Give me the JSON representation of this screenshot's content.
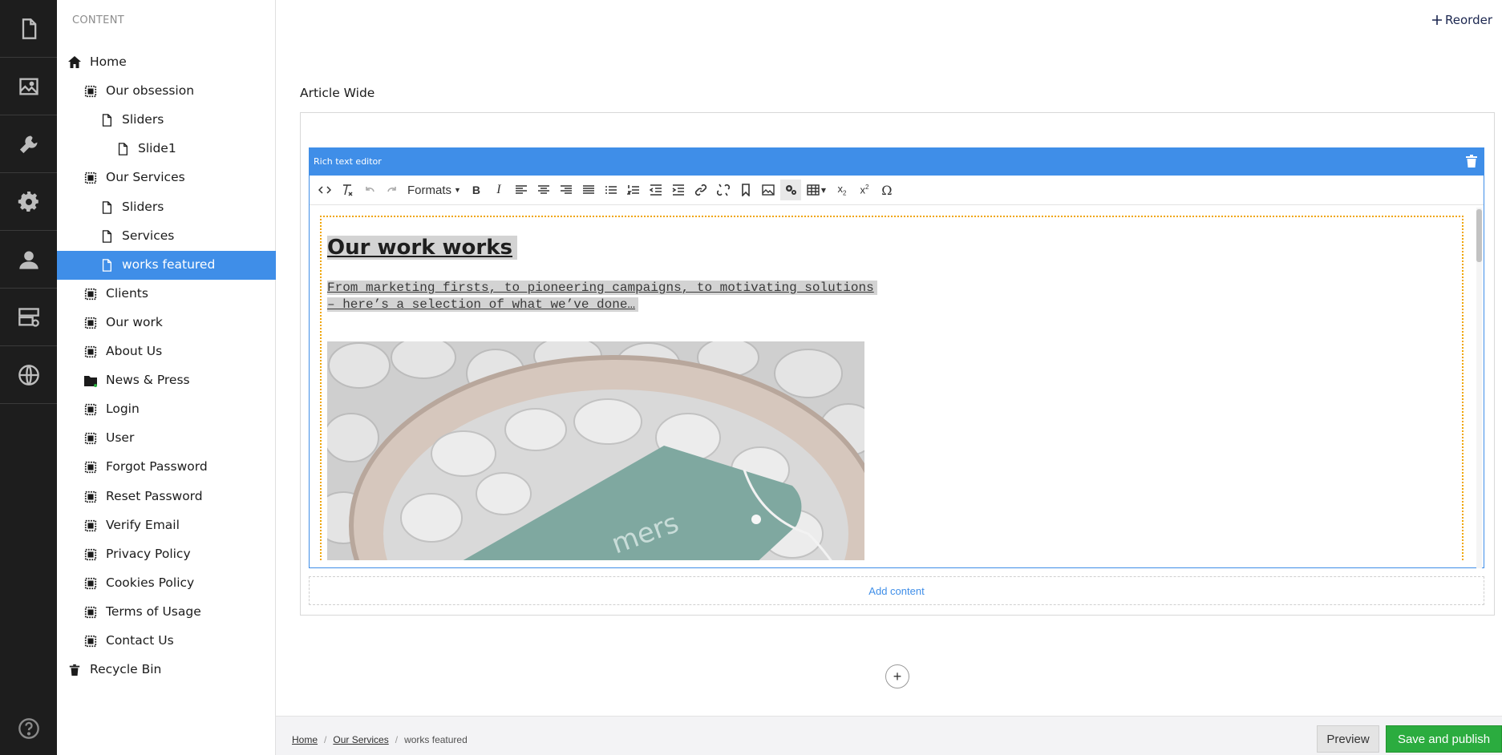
{
  "rail": {
    "items": [
      {
        "name": "content-icon"
      },
      {
        "name": "media-icon"
      },
      {
        "name": "settings-wrench-icon"
      },
      {
        "name": "developer-gear-icon"
      },
      {
        "name": "users-icon"
      },
      {
        "name": "forms-icon"
      },
      {
        "name": "translation-globe-icon"
      }
    ],
    "help": "help-icon"
  },
  "tree": {
    "heading": "CONTENT",
    "items": [
      {
        "label": "Home",
        "icon": "home-icon",
        "level": 0
      },
      {
        "label": "Our obsession",
        "icon": "page-grid-icon",
        "level": 1
      },
      {
        "label": "Sliders",
        "icon": "document-icon",
        "level": 2
      },
      {
        "label": "Slide1",
        "icon": "document-icon",
        "level": 3
      },
      {
        "label": "Our Services",
        "icon": "page-grid-icon",
        "level": 1
      },
      {
        "label": "Sliders",
        "icon": "document-icon",
        "level": 2
      },
      {
        "label": "Services",
        "icon": "document-icon",
        "level": 2
      },
      {
        "label": "works featured",
        "icon": "document-icon",
        "level": 2,
        "active": true
      },
      {
        "label": "Clients",
        "icon": "page-grid-icon",
        "level": 1
      },
      {
        "label": "Our work",
        "icon": "page-grid-icon",
        "level": 1
      },
      {
        "label": "About Us",
        "icon": "page-grid-icon",
        "level": 1
      },
      {
        "label": "News & Press",
        "icon": "folder-icon",
        "level": 1
      },
      {
        "label": "Login",
        "icon": "page-grid-icon",
        "level": 1
      },
      {
        "label": "User",
        "icon": "page-grid-icon",
        "level": 1
      },
      {
        "label": "Forgot Password",
        "icon": "page-grid-icon",
        "level": 1
      },
      {
        "label": "Reset Password",
        "icon": "page-grid-icon",
        "level": 1
      },
      {
        "label": "Verify Email",
        "icon": "page-grid-icon",
        "level": 1
      },
      {
        "label": "Privacy Policy",
        "icon": "page-grid-icon",
        "level": 1
      },
      {
        "label": "Cookies Policy",
        "icon": "page-grid-icon",
        "level": 1
      },
      {
        "label": "Terms of Usage",
        "icon": "page-grid-icon",
        "level": 1
      },
      {
        "label": "Contact Us",
        "icon": "page-grid-icon",
        "level": 1
      },
      {
        "label": "Recycle Bin",
        "icon": "trash-icon",
        "level": 0
      }
    ]
  },
  "main": {
    "reorder_label": "Reorder",
    "section_title": "Article Wide",
    "editor": {
      "label": "Rich text editor",
      "formats_label": "Formats",
      "heading": "Our work works",
      "paragraph_line1": "From marketing firsts, to pioneering campaigns, to motivating solutions ",
      "paragraph_line2": "– here’s a selection of what we’ve done…"
    },
    "add_content_label": "Add content"
  },
  "footer": {
    "breadcrumb": [
      "Home",
      "Our Services",
      "works featured"
    ],
    "preview_label": "Preview",
    "publish_label": "Save and publish"
  },
  "colors": {
    "accent": "#3f8ee8",
    "rail": "#1d1d1d",
    "publish": "#2bac3f",
    "outline": "#f0a500"
  }
}
